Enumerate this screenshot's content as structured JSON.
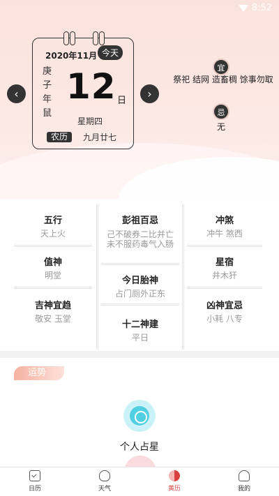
{
  "status_bar": {
    "time": "8:52"
  },
  "calendar": {
    "date": "2020年11月",
    "today_badge": "今天",
    "ganzhi": [
      "庚",
      "子",
      "年",
      "鼠"
    ],
    "day": "12",
    "day_unit": "日",
    "weekday": "星期四",
    "lunar_badge": "农历",
    "lunar_date": "九月廿七"
  },
  "yi_ji": {
    "yi_label": "宜",
    "yi_text": "祭祀 结网 造畜稠 馀事勿取",
    "ji_label": "忌",
    "ji_text": "无"
  },
  "almanac": {
    "wuxing": {
      "title": "五行",
      "value": "天上火"
    },
    "pengzu": {
      "title": "彭祖百忌",
      "value": "己不破券二比并亡未不服药毒气入肠"
    },
    "chongsha": {
      "title": "冲煞",
      "value": "冲牛 煞西"
    },
    "zhishen": {
      "title": "值神",
      "value": "明堂"
    },
    "taishen": {
      "title": "今日胎神",
      "value": "占门厕外正东"
    },
    "xingxiu": {
      "title": "星宿",
      "value": "井木犴"
    },
    "jishen": {
      "title": "吉神宜趋",
      "value": "敬安 玉堂"
    },
    "shier": {
      "title": "十二神建",
      "value": "平日"
    },
    "xiongshen": {
      "title": "凶神宜忌",
      "value": "小耗 八专"
    }
  },
  "fortune": {
    "badge": "运势",
    "item_label": "个人占星"
  },
  "bottom_nav": [
    {
      "label": "日历",
      "icon": "calendar-icon"
    },
    {
      "label": "天气",
      "icon": "weather-icon"
    },
    {
      "label": "黄历",
      "icon": "almanac-icon"
    },
    {
      "label": "我的",
      "icon": "profile-icon"
    }
  ],
  "colors": {
    "accent": "#e04848",
    "dark": "#333333",
    "header_bg": "#fbe3dd"
  }
}
